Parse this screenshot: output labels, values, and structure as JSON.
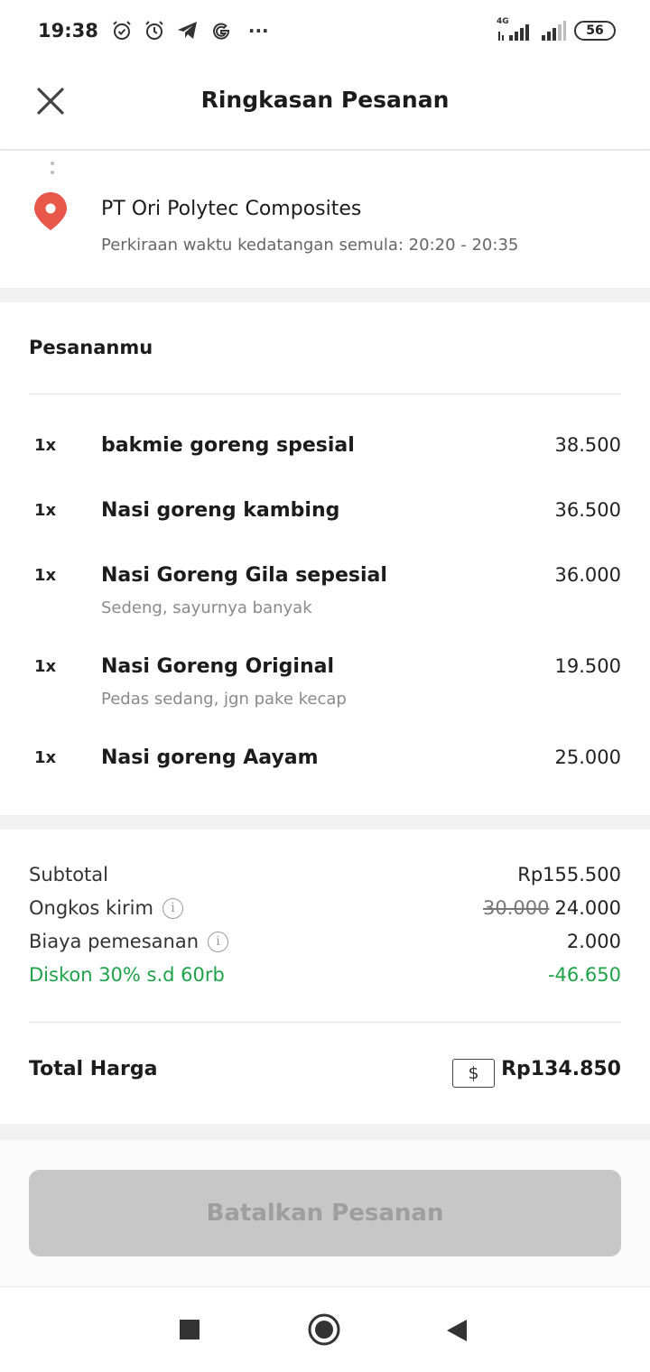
{
  "status_bar": {
    "time": "19:38",
    "network_label": "4G",
    "battery": "56",
    "more_indicator": "···"
  },
  "header": {
    "title": "Ringkasan Pesanan"
  },
  "destination": {
    "name": "PT Ori Polytec Composites",
    "eta": "Perkiraan waktu kedatangan semula: 20:20 - 20:35"
  },
  "order": {
    "heading": "Pesananmu",
    "items": [
      {
        "qty": "1x",
        "name": "bakmie goreng spesial",
        "note": "",
        "price": "38.500"
      },
      {
        "qty": "1x",
        "name": "Nasi goreng kambing",
        "note": "",
        "price": "36.500"
      },
      {
        "qty": "1x",
        "name": "Nasi Goreng Gila sepesial",
        "note": "Sedeng, sayurnya banyak",
        "price": "36.000"
      },
      {
        "qty": "1x",
        "name": "Nasi Goreng Original",
        "note": "Pedas sedang, jgn pake kecap",
        "price": "19.500"
      },
      {
        "qty": "1x",
        "name": "Nasi goreng Aayam",
        "note": "",
        "price": "25.000"
      }
    ]
  },
  "summary": {
    "subtotal_label": "Subtotal",
    "subtotal_value": "Rp155.500",
    "delivery_label": "Ongkos kirim",
    "delivery_original": "30.000",
    "delivery_value": "24.000",
    "fee_label": "Biaya pemesanan",
    "fee_value": "2.000",
    "discount_label": "Diskon 30% s.d 60rb",
    "discount_value": "-46.650",
    "total_label": "Total Harga",
    "payment_symbol": "$",
    "total_value": "Rp134.850",
    "info_glyph": "i"
  },
  "actions": {
    "cancel_label": "Batalkan Pesanan"
  },
  "colors": {
    "accent_green": "#1fa24a",
    "pin_red": "#e8574a",
    "disabled_button": "#c7c7c7"
  }
}
